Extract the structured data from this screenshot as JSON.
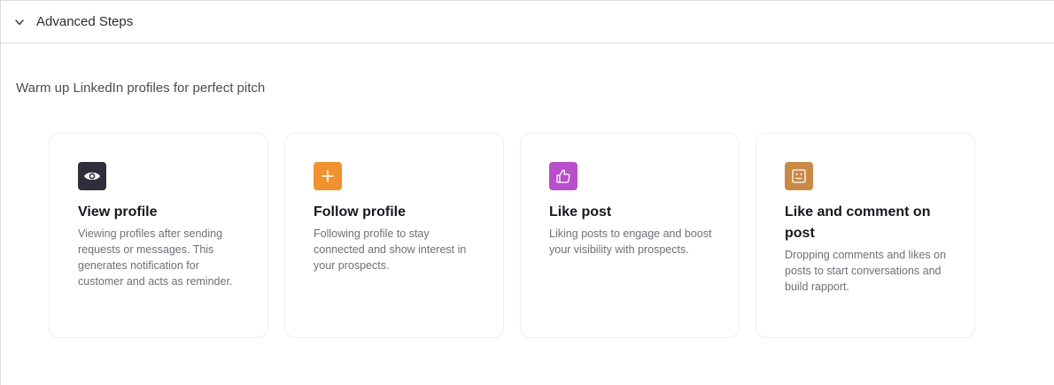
{
  "section": {
    "title": "Advanced Steps",
    "subtitle": "Warm up LinkedIn profiles for perfect pitch"
  },
  "cards": [
    {
      "title": "View profile",
      "description": "Viewing profiles after sending requests or messages. This generates notification for customer and acts as reminder.",
      "icon": "eye-icon",
      "color": "#2e2f3a"
    },
    {
      "title": "Follow profile",
      "description": "Following profile to stay connected and show interest in your prospects.",
      "icon": "plus-icon",
      "color": "#f0922f"
    },
    {
      "title": "Like post",
      "description": "Liking posts to engage and boost your visibility with prospects.",
      "icon": "thumbs-up-icon",
      "color": "#b84fcb"
    },
    {
      "title": "Like and comment on post",
      "description": "Dropping comments and likes on posts to start conversations and build rapport.",
      "icon": "comment-icon",
      "color": "#c98a45"
    }
  ]
}
